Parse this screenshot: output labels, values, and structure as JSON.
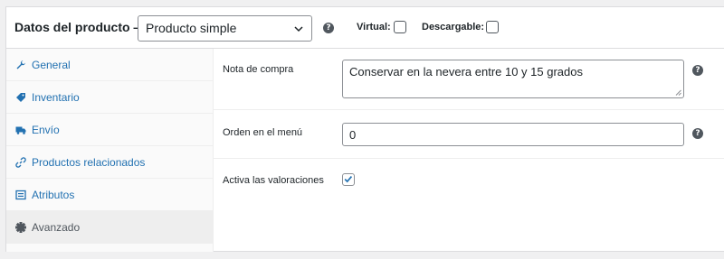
{
  "header": {
    "title": "Datos del producto —",
    "product_type": {
      "selected": "Producto simple"
    },
    "virtual_label": "Virtual:",
    "virtual_checked": false,
    "downloadable_label": "Descargable:",
    "downloadable_checked": false
  },
  "tabs": [
    {
      "label": "General",
      "icon": "wrench-icon",
      "active": false
    },
    {
      "label": "Inventario",
      "icon": "tag-icon",
      "active": false
    },
    {
      "label": "Envío",
      "icon": "truck-icon",
      "active": false
    },
    {
      "label": "Productos relacionados",
      "icon": "link-icon",
      "active": false
    },
    {
      "label": "Atributos",
      "icon": "list-icon",
      "active": false
    },
    {
      "label": "Avanzado",
      "icon": "gear-icon",
      "active": true
    }
  ],
  "advanced": {
    "purchase_note_label": "Nota de compra",
    "purchase_note_value": "Conservar en la nevera entre 10 y 15 grados",
    "menu_order_label": "Orden en el menú",
    "menu_order_value": "0",
    "reviews_label": "Activa las valoraciones",
    "reviews_enabled": true
  },
  "colors": {
    "link": "#2271b1",
    "border": "#dcdcde",
    "active_tab_bg": "#eeeeee",
    "panel_bg": "#ffffff",
    "page_bg": "#f0f0f1"
  }
}
